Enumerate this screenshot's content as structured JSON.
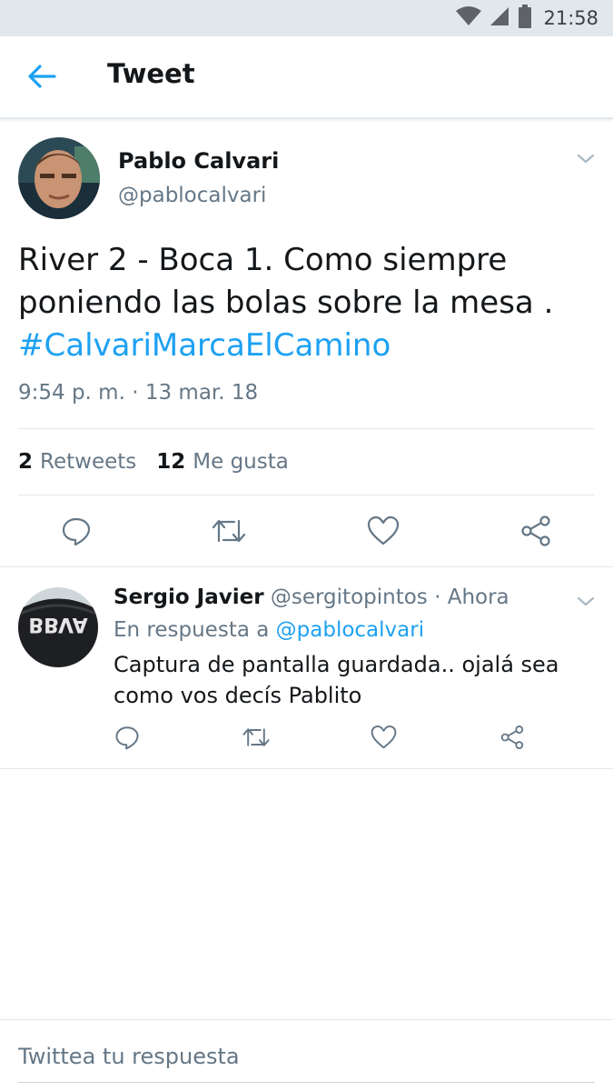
{
  "status_bar": {
    "time": "21:58",
    "icons": [
      "wifi-icon",
      "cell-signal-icon",
      "battery-icon"
    ]
  },
  "app_bar": {
    "back_icon": "arrow-left-icon",
    "title": "Tweet"
  },
  "tweet": {
    "author_name": "Pablo Calvari",
    "author_handle": "@pablocalvari",
    "text_line1": "River 2 - Boca 1. Como siempre",
    "text_line2": "poniendo las bolas sobre la mesa .",
    "hashtag": "#CalvariMarcaElCamino",
    "timestamp": "9:54 p. m. · 13 mar. 18",
    "retweets_count": "2",
    "retweets_label": "Retweets",
    "likes_count": "12",
    "likes_label": "Me gusta",
    "actions": [
      "reply-icon",
      "retweet-icon",
      "like-icon",
      "share-icon"
    ]
  },
  "reply": {
    "author_name": "Sergio Javier",
    "author_handle": "@sergitopintos",
    "time_label": "· Ahora",
    "context_prefix": "En respuesta a",
    "context_mention": "@pablocalvari",
    "text_line1": "Captura de pantalla guardada.. ojalá sea",
    "text_line2": "como vos decís Pablito",
    "avatar_text": "BBVA"
  },
  "compose": {
    "placeholder": "Twittea tu respuesta"
  },
  "colors": {
    "accent": "#1da1f2",
    "secondary_text": "#657786",
    "primary_text": "#14171a",
    "divider": "#e1e8ed"
  }
}
